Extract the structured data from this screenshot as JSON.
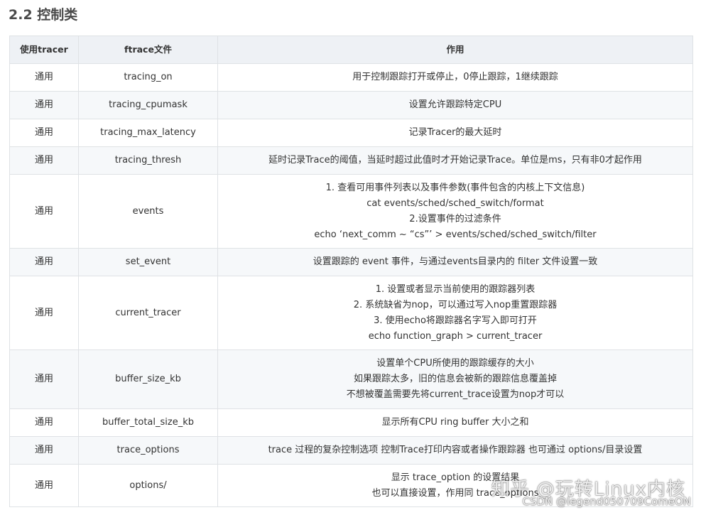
{
  "heading": "2.2 控制类",
  "table": {
    "headers": [
      "使用tracer",
      "ftrace文件",
      "作用"
    ],
    "rows": [
      {
        "scope": "通用",
        "file": "tracing_on",
        "desc": [
          "用于控制跟踪打开或停止，0停止跟踪，1继续跟踪"
        ]
      },
      {
        "scope": "通用",
        "file": "tracing_cpumask",
        "desc": [
          "设置允许跟踪特定CPU"
        ]
      },
      {
        "scope": "通用",
        "file": "tracing_max_latency",
        "desc": [
          "记录Tracer的最大延时"
        ]
      },
      {
        "scope": "通用",
        "file": "tracing_thresh",
        "desc": [
          "延时记录Trace的阈值，当延时超过此值时才开始记录Trace。单位是ms，只有非0才起作用"
        ]
      },
      {
        "scope": "通用",
        "file": "events",
        "desc": [
          "1. 查看可用事件列表以及事件参数(事件包含的内核上下文信息)",
          "cat events/sched/sched_switch/format",
          "2.设置事件的过滤条件",
          "echo ‘next_comm ~ “cs”’ > events/sched/sched_switch/filter"
        ]
      },
      {
        "scope": "通用",
        "file": "set_event",
        "desc": [
          "设置跟踪的 event 事件，与通过events目录内的 filter 文件设置一致"
        ]
      },
      {
        "scope": "通用",
        "file": "current_tracer",
        "desc": [
          "1. 设置或者显示当前使用的跟踪器列表",
          "2. 系统缺省为nop，可以通过写入nop重置跟踪器",
          "3. 使用echo将跟踪器名字写入即可打开",
          "echo function_graph > current_tracer"
        ]
      },
      {
        "scope": "通用",
        "file": "buffer_size_kb",
        "desc": [
          "设置单个CPU所使用的跟踪缓存的大小",
          "如果跟踪太多，旧的信息会被新的跟踪信息覆盖掉",
          "不想被覆盖需要先将current_trace设置为nop才可以"
        ]
      },
      {
        "scope": "通用",
        "file": "buffer_total_size_kb",
        "desc": [
          "显示所有CPU ring buffer 大小之和"
        ]
      },
      {
        "scope": "通用",
        "file": "trace_options",
        "desc": [
          "trace 过程的复杂控制选项 控制Trace打印内容或者操作跟踪器 也可通过 options/目录设置"
        ]
      },
      {
        "scope": "通用",
        "file": "options/",
        "desc": [
          "显示 trace_option 的设置结果",
          "也可以直接设置，作用同 trace_options"
        ]
      }
    ]
  },
  "watermark": {
    "main": "知乎 @玩转Linux内核",
    "sub": "CSDN @legend050709ComeON"
  }
}
